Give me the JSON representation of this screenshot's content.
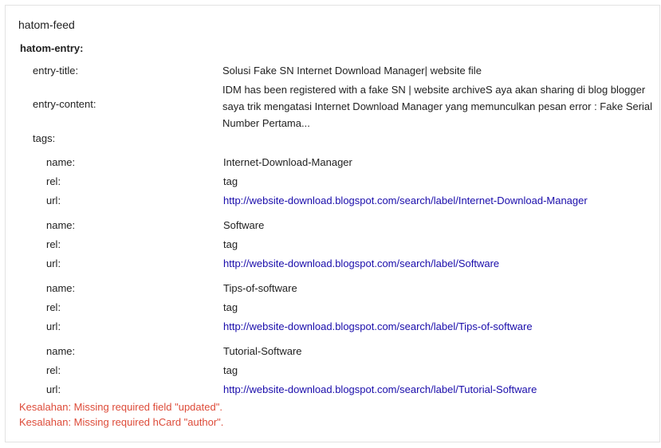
{
  "feed": {
    "title": "hatom-feed"
  },
  "entry": {
    "heading": "hatom-entry:",
    "title_label": "entry-title:",
    "title_value": "Solusi Fake SN Internet Download Manager| website file",
    "content_label": "entry-content:",
    "content_value": "IDM has been registered with a fake SN | website archiveS aya akan sharing di blog blogger saya trik mengatasi Internet Download Manager yang memunculkan pesan error : Fake Serial Number Pertama...",
    "tags_label": "tags:"
  },
  "tag_labels": {
    "name": "name:",
    "rel": "rel:",
    "url": "url:"
  },
  "tags": [
    {
      "name": "Internet-Download-Manager",
      "rel": "tag",
      "url": "http://website-download.blogspot.com/search/label/Internet-Download-Manager"
    },
    {
      "name": "Software",
      "rel": "tag",
      "url": "http://website-download.blogspot.com/search/label/Software"
    },
    {
      "name": "Tips-of-software",
      "rel": "tag",
      "url": "http://website-download.blogspot.com/search/label/Tips-of-software"
    },
    {
      "name": "Tutorial-Software",
      "rel": "tag",
      "url": "http://website-download.blogspot.com/search/label/Tutorial-Software"
    }
  ],
  "errors": [
    "Kesalahan: Missing required field \"updated\".",
    "Kesalahan: Missing required hCard \"author\"."
  ],
  "colors": {
    "link": "#1a0dab",
    "error": "#dd4b39",
    "border": "#e2e2e2"
  }
}
